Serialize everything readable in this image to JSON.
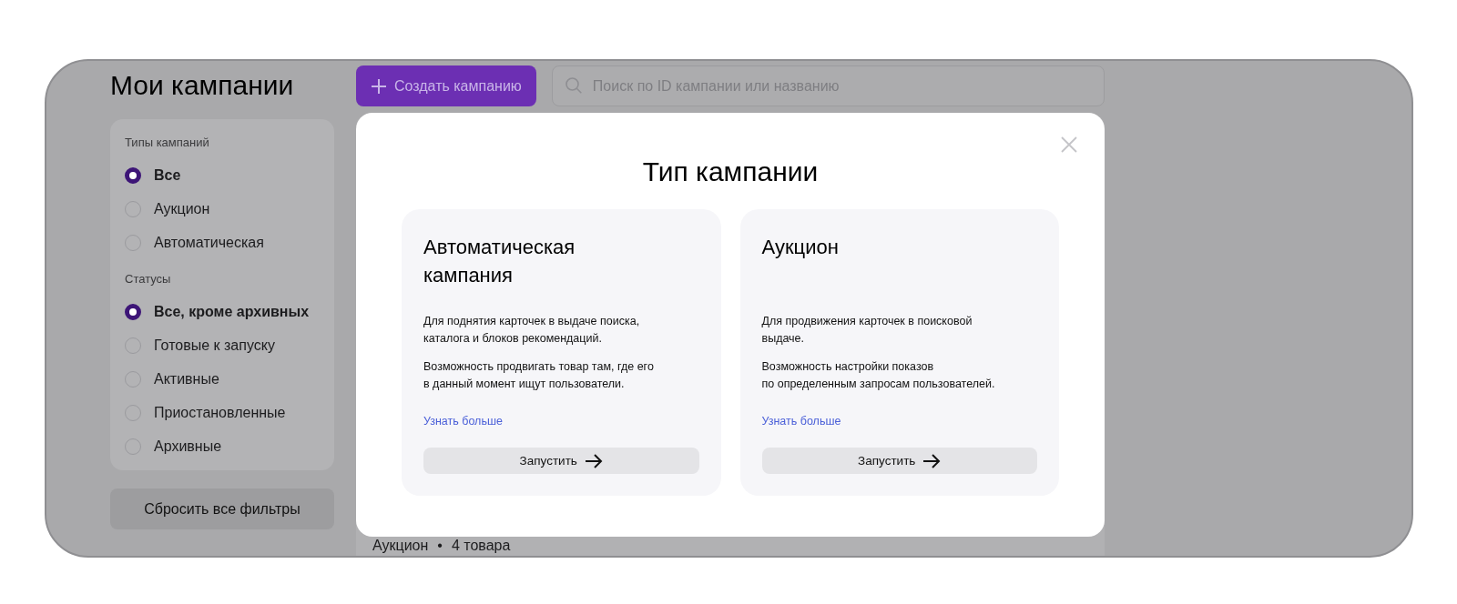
{
  "page": {
    "title": "Мои кампании"
  },
  "create_button": {
    "label": "Создать кампанию"
  },
  "search": {
    "placeholder": "Поиск по ID кампании или названию"
  },
  "filters": {
    "groups": [
      {
        "title": "Типы кампаний",
        "options": [
          {
            "label": "Все",
            "selected": true
          },
          {
            "label": "Аукцион",
            "selected": false
          },
          {
            "label": "Автоматическая",
            "selected": false
          }
        ]
      },
      {
        "title": "Статусы",
        "options": [
          {
            "label": "Все, кроме архивных",
            "selected": true
          },
          {
            "label": "Готовые к запуску",
            "selected": false
          },
          {
            "label": "Активные",
            "selected": false
          },
          {
            "label": "Приостановленные",
            "selected": false
          },
          {
            "label": "Архивные",
            "selected": false
          }
        ]
      }
    ],
    "reset_button": "Сбросить все фильтры"
  },
  "campaign_row": {
    "type": "Аукцион",
    "separator": "•",
    "count": "4 товара"
  },
  "modal": {
    "title": "Тип кампании",
    "options": [
      {
        "title": "Автоматическая кампания",
        "paragraphs": [
          [
            "Для поднятия карточек в выдаче поиска,",
            "каталога и блоков рекомендаций."
          ],
          [
            "Возможность продвигать товар там, где его",
            "в данный момент ищут пользователи."
          ]
        ],
        "link": "Узнать больше",
        "button": "Запустить"
      },
      {
        "title": "Аукцион",
        "paragraphs": [
          [
            "Для продвижения карточек в поисковой",
            "выдаче."
          ],
          [
            "Возможность настройки показов",
            "по определенным запросам пользователей."
          ]
        ],
        "link": "Узнать больше",
        "button": "Запустить"
      }
    ]
  }
}
